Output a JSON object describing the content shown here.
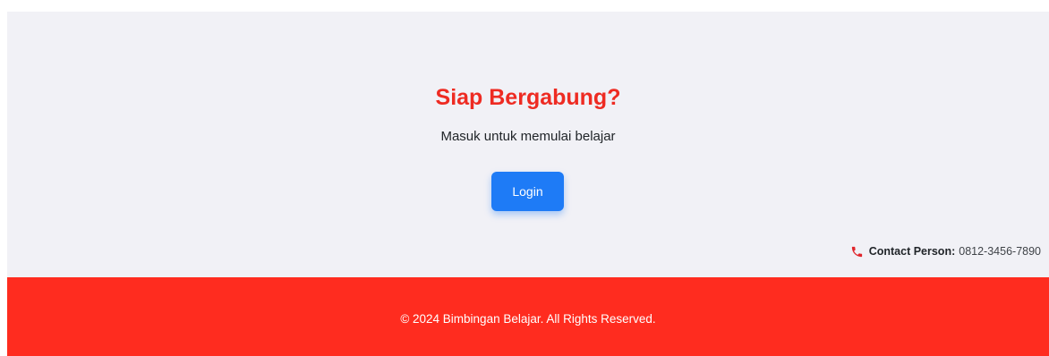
{
  "cta": {
    "title": "Siap Bergabung?",
    "subtitle": "Masuk untuk memulai belajar",
    "login_label": "Login"
  },
  "contact": {
    "icon": "phone-icon",
    "label": "Contact Person:",
    "phone": "0812-3456-7890"
  },
  "footer": {
    "copyright": "© 2024 Bimbingan Belajar. All Rights Reserved."
  },
  "colors": {
    "accent_red": "#ee2b22",
    "footer_red": "#ff2c1f",
    "button_blue": "#1e7bf6",
    "section_bg": "#f1f1f6"
  }
}
